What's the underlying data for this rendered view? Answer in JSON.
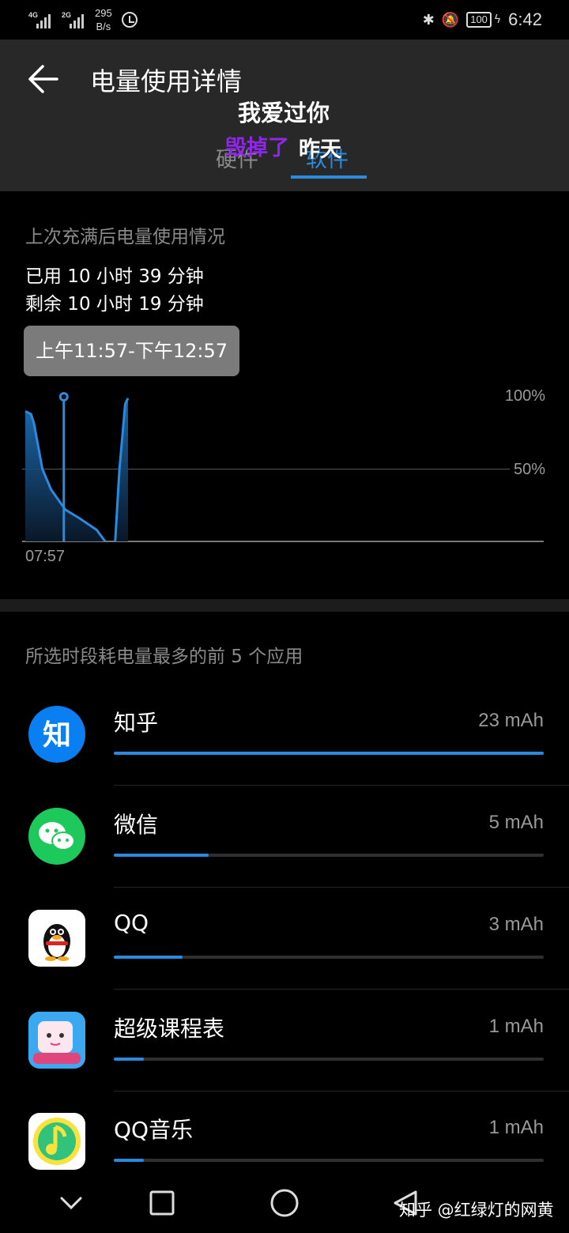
{
  "status_bar": {
    "network_1": "4G",
    "network_2": "2G",
    "speed_value": "295",
    "speed_unit": "B/s",
    "battery": "100",
    "time": "6:42"
  },
  "header": {
    "title": "电量使用详情",
    "overlay_text_1": "我爱过你",
    "overlay_text_2": "毁掉了",
    "overlay_text_3": "昨天",
    "tabs": [
      {
        "label": "硬件",
        "active": false
      },
      {
        "label": "软件",
        "active": true
      }
    ],
    "accent_color": "#2a8ae0"
  },
  "usage": {
    "section_label": "上次充满后电量使用情况",
    "used": "已用 10 小时 39 分钟",
    "remaining": "剩余 10 小时 19 分钟",
    "selected_range": "上午11:57-下午12:57"
  },
  "chart_data": {
    "type": "area",
    "y_tick_labels": [
      "100%",
      "50%"
    ],
    "x_tick_labels": [
      "07:57"
    ],
    "ylim": [
      0,
      100
    ],
    "series": [
      {
        "segment": 1,
        "x": [
          0,
          4,
          6,
          12,
          18,
          28,
          38,
          50,
          56
        ],
        "values": [
          90,
          88,
          82,
          50,
          36,
          22,
          16,
          8,
          0
        ]
      },
      {
        "segment": 2,
        "x": [
          63,
          66,
          70,
          72
        ],
        "values": [
          0,
          50,
          95,
          99
        ]
      }
    ],
    "selection_marker_x": 27
  },
  "top_apps": {
    "section_label": "所选时段耗电量最多的前 5 个应用",
    "items": [
      {
        "name": "知乎",
        "value": "23 mAh",
        "fraction": 1.0,
        "icon": "zhihu-icon",
        "color": "#0a7ff2"
      },
      {
        "name": "微信",
        "value": "5 mAh",
        "fraction": 0.22,
        "icon": "wechat-icon",
        "color": "#1ec95c"
      },
      {
        "name": "QQ",
        "value": "3 mAh",
        "fraction": 0.16,
        "icon": "qq-icon",
        "color": "#ffffff"
      },
      {
        "name": "超级课程表",
        "value": "1 mAh",
        "fraction": 0.07,
        "icon": "super-schedule-icon",
        "color": "#2ea6f0"
      },
      {
        "name": "QQ音乐",
        "value": "1 mAh",
        "fraction": 0.07,
        "icon": "qq-music-icon",
        "color": "#f8e23b"
      }
    ]
  },
  "watermark": "知乎 @红绿灯的网黄"
}
